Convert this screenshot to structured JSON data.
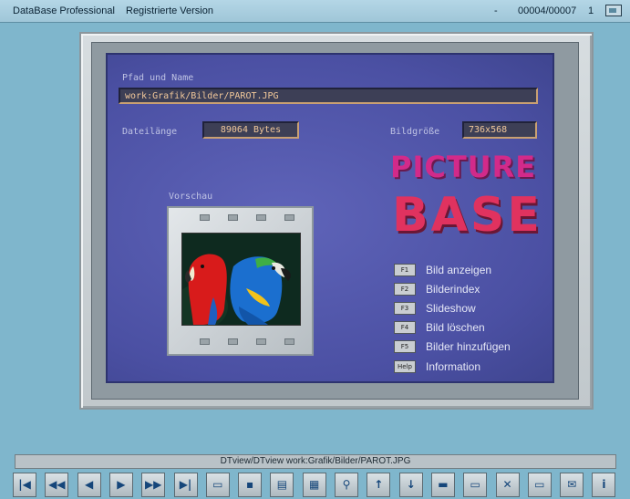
{
  "titlebar": {
    "app_title": "DataBase Professional",
    "registration": "Registrierte Version",
    "minus": "-",
    "record_counter": "00004/00007",
    "page": "1"
  },
  "form": {
    "path_label": "Pfad und Name",
    "path_value": "work:Grafik/Bilder/PAROT.JPG",
    "size_label": "Dateilänge",
    "size_value": "89064 Bytes",
    "dim_label": "Bildgröße",
    "dim_value": "736x568",
    "preview_label": "Vorschau"
  },
  "logo": {
    "line1": "PICTURE",
    "line2": "BASE"
  },
  "function_keys": [
    {
      "key": "F1",
      "label": "Bild anzeigen"
    },
    {
      "key": "F2",
      "label": "Bilderindex"
    },
    {
      "key": "F3",
      "label": "Slideshow"
    },
    {
      "key": "F4",
      "label": "Bild löschen"
    },
    {
      "key": "F5",
      "label": "Bilder hinzufügen"
    },
    {
      "key": "Help",
      "label": "Information"
    }
  ],
  "status_bar": {
    "text": "DTview/DTview  work:Grafik/Bilder/PAROT.JPG"
  },
  "toolbar": {
    "buttons": [
      {
        "icon": "first-record-icon",
        "glyph": "|◀"
      },
      {
        "icon": "rewind-icon",
        "glyph": "◀◀"
      },
      {
        "icon": "previous-icon",
        "glyph": "◀"
      },
      {
        "icon": "next-icon",
        "glyph": "▶"
      },
      {
        "icon": "fast-forward-icon",
        "glyph": "▶▶"
      },
      {
        "icon": "last-record-icon",
        "glyph": "▶|"
      },
      {
        "icon": "open-folder-icon",
        "glyph": "▭"
      },
      {
        "icon": "save-disk-icon",
        "glyph": "▪"
      },
      {
        "icon": "keyboard-icon",
        "glyph": "▤"
      },
      {
        "icon": "cards-icon",
        "glyph": "▦"
      },
      {
        "icon": "magnifier-icon",
        "glyph": "⚲"
      },
      {
        "icon": "arrow-up-icon",
        "glyph": "↑"
      },
      {
        "icon": "arrow-down-icon",
        "glyph": "↓"
      },
      {
        "icon": "box-icon",
        "glyph": "▬"
      },
      {
        "icon": "folder-icon",
        "glyph": "▭"
      },
      {
        "icon": "delete-folder-icon",
        "glyph": "✕"
      },
      {
        "icon": "folders-icon",
        "glyph": "▭"
      },
      {
        "icon": "mail-icon",
        "glyph": "✉"
      },
      {
        "icon": "info-icon",
        "glyph": "i"
      }
    ]
  },
  "colors": {
    "panel_blue": "#5459ad",
    "field_text": "#f2c89a",
    "logo_magenta": "#d22a8a",
    "logo_red": "#e0325f"
  }
}
